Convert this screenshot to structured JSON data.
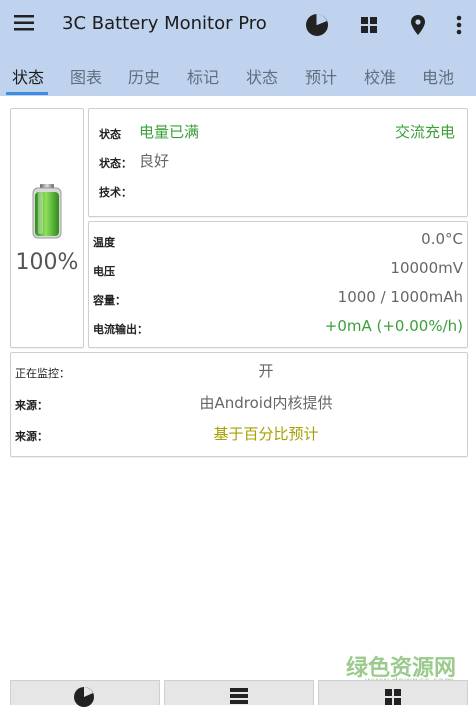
{
  "app": {
    "title": "3C Battery Monitor Pro"
  },
  "tabs": [
    "状态",
    "图表",
    "历史",
    "标记",
    "状态",
    "预计",
    "校准",
    "电池"
  ],
  "battery": {
    "percent_label": "100%",
    "level": 1.0
  },
  "status_card": {
    "status_label": "状态",
    "status_value": "电量已满",
    "charge_type": "交流充电",
    "health_label": "状态：",
    "health_value": "良好",
    "tech_label": "技术："
  },
  "metrics_card": {
    "temp_label": "温度",
    "temp_value": "0.0°C",
    "voltage_label": "电压",
    "voltage_value": "10000mV",
    "capacity_label": "容量：",
    "capacity_value": "1000 / 1000mAh",
    "current_label": "电流输出：",
    "current_value": "+0mA (+0.00%/h)"
  },
  "monitor_card": {
    "monitoring_label": "正在监控：",
    "monitoring_value": "开",
    "source1_label": "来源：",
    "source1_value": "由Android内核提供",
    "source2_label": "来源：",
    "source2_value": "基于百分比预计"
  },
  "watermark": {
    "main": "绿色资源网",
    "url": "www.downcc.com"
  },
  "colors": {
    "appbar": "#bfd3ee",
    "accent_green": "#3aa03a",
    "olive": "#a7a000",
    "tab_indicator": "#3e8be0"
  }
}
